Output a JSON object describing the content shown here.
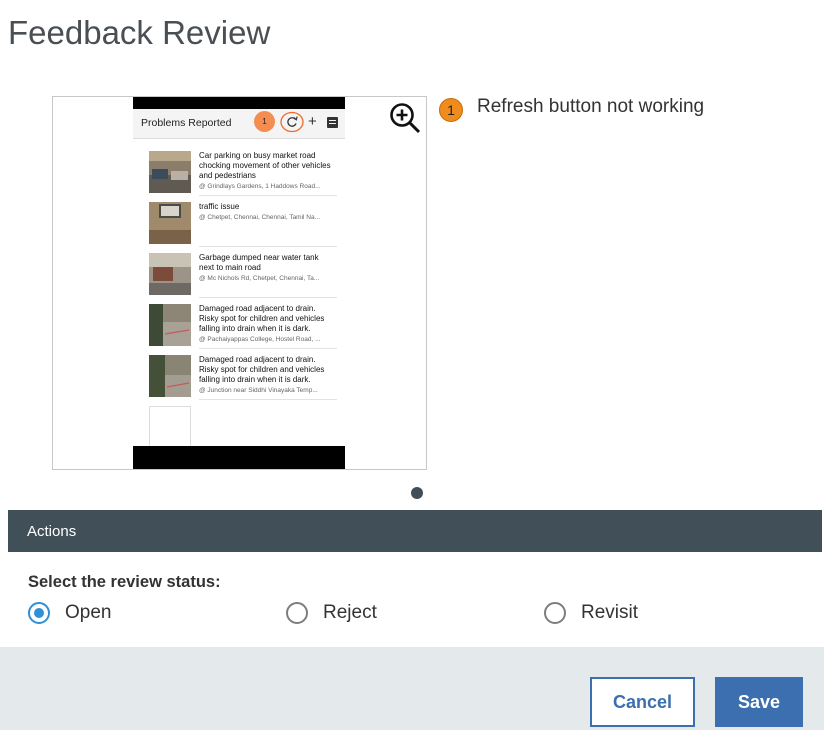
{
  "page": {
    "title": "Feedback Review"
  },
  "preview": {
    "app_title": "Problems Reported",
    "marker_number": "1",
    "items": [
      {
        "title": "Car parking on busy market road chocking movement of other vehicles and pedestrians",
        "location": "@ Grindlays Gardens, 1 Haddows Road..."
      },
      {
        "title": "traffic issue",
        "location": "@ Chetpet, Chennai, Chennai, Tamil Na..."
      },
      {
        "title": "Garbage dumped near water tank next to main road",
        "location": "@ Mc Nichols Rd, Chetpet, Chennai, Ta..."
      },
      {
        "title": "Damaged road adjacent to drain. Risky spot for children and vehicles falling into drain when it is dark.",
        "location": "@ Pachaiyappas College, Hostel Road, ..."
      },
      {
        "title": "Damaged road adjacent to drain. Risky spot for children and vehicles falling into drain when it is dark.",
        "location": "@ Junction near Siddhi Vinayaka Temp..."
      }
    ]
  },
  "annotation": {
    "number": "1",
    "text": "Refresh button not working"
  },
  "actions": {
    "header": "Actions"
  },
  "review": {
    "label": "Select the review status:",
    "options": [
      {
        "label": "Open",
        "selected": true
      },
      {
        "label": "Reject",
        "selected": false
      },
      {
        "label": "Revisit",
        "selected": false
      }
    ]
  },
  "buttons": {
    "cancel": "Cancel",
    "save": "Save"
  },
  "colors": {
    "accent": "#3b6faf",
    "actions_bar": "#414f58",
    "marker": "#f08b1d",
    "radio_selected": "#2f8fd8"
  }
}
